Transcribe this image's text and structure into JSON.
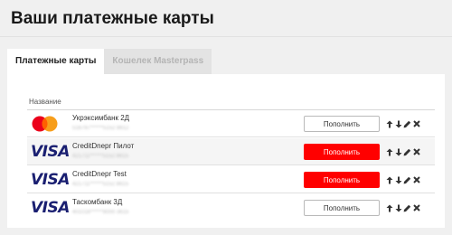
{
  "page": {
    "title": "Ваши платежные карты"
  },
  "tabs": [
    {
      "label": "Платежные карты",
      "active": true
    },
    {
      "label": "Кошелек Masterpass",
      "active": false
    }
  ],
  "table": {
    "column_header": "Название",
    "rows": [
      {
        "brand_icon": "mastercard-logo",
        "logo_text": "",
        "name": "Укрэксимбанк 2Д",
        "number": "516797******5152 8612",
        "action_label": "Пополнить",
        "action_style": "outline"
      },
      {
        "brand_icon": "visa-logo",
        "logo_text": "VISA",
        "name": "CreditDnepr Пилот",
        "number": "421711******5152 8615",
        "action_label": "Пополнить",
        "action_style": "filled"
      },
      {
        "brand_icon": "visa-logo",
        "logo_text": "VISA",
        "name": "CreditDnepr Test",
        "number": "421711******5152 8615",
        "action_label": "Пополнить",
        "action_style": "filled"
      },
      {
        "brand_icon": "visa-logo",
        "logo_text": "VISA",
        "name": "Таскомбанк 3Д",
        "number": "401016******8000 3615",
        "action_label": "Пополнить",
        "action_style": "outline"
      }
    ],
    "row_actions": [
      "arrow-up-icon",
      "arrow-down-icon",
      "pencil-icon",
      "close-icon"
    ]
  },
  "colors": {
    "accent_red": "#ff0000",
    "visa_blue": "#1a1f71",
    "mastercard_red": "#eb001b",
    "mastercard_yellow": "#f79e1b"
  }
}
